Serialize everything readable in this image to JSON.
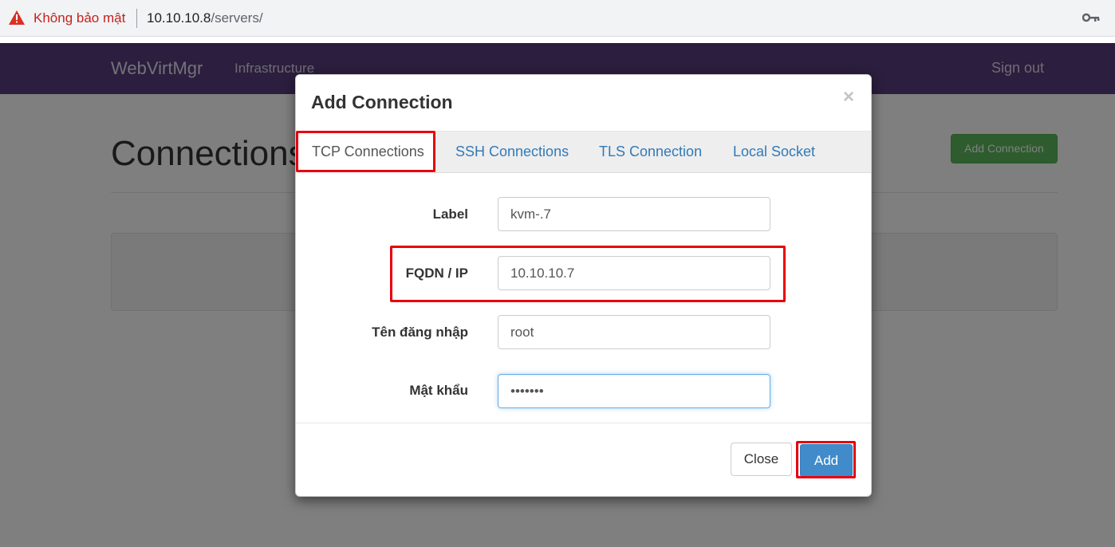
{
  "browser": {
    "security_warning": "Không bảo mật",
    "url_host": "10.10.10.8",
    "url_path": "/servers/",
    "warning_color": "#c5221f"
  },
  "navbar": {
    "brand": "WebVirtMgr",
    "nav_item": "Infrastructure",
    "sign_out": "Sign out",
    "background": "#563d7c"
  },
  "page": {
    "title": "Connections",
    "add_button": "Add Connection"
  },
  "modal": {
    "title": "Add Connection",
    "close_symbol": "×",
    "tabs": [
      {
        "label": "TCP Connections",
        "active": true
      },
      {
        "label": "SSH Connections",
        "active": false
      },
      {
        "label": "TLS Connection",
        "active": false
      },
      {
        "label": "Local Socket",
        "active": false
      }
    ],
    "fields": {
      "label": {
        "label": "Label",
        "value": "kvm-.7"
      },
      "fqdn": {
        "label": "FQDN / IP",
        "value": "10.10.10.7"
      },
      "username": {
        "label": "Tên đăng nhập",
        "value": "root"
      },
      "password": {
        "label": "Mật khẩu",
        "value": "•••••••"
      }
    },
    "buttons": {
      "close": "Close",
      "add": "Add"
    }
  }
}
